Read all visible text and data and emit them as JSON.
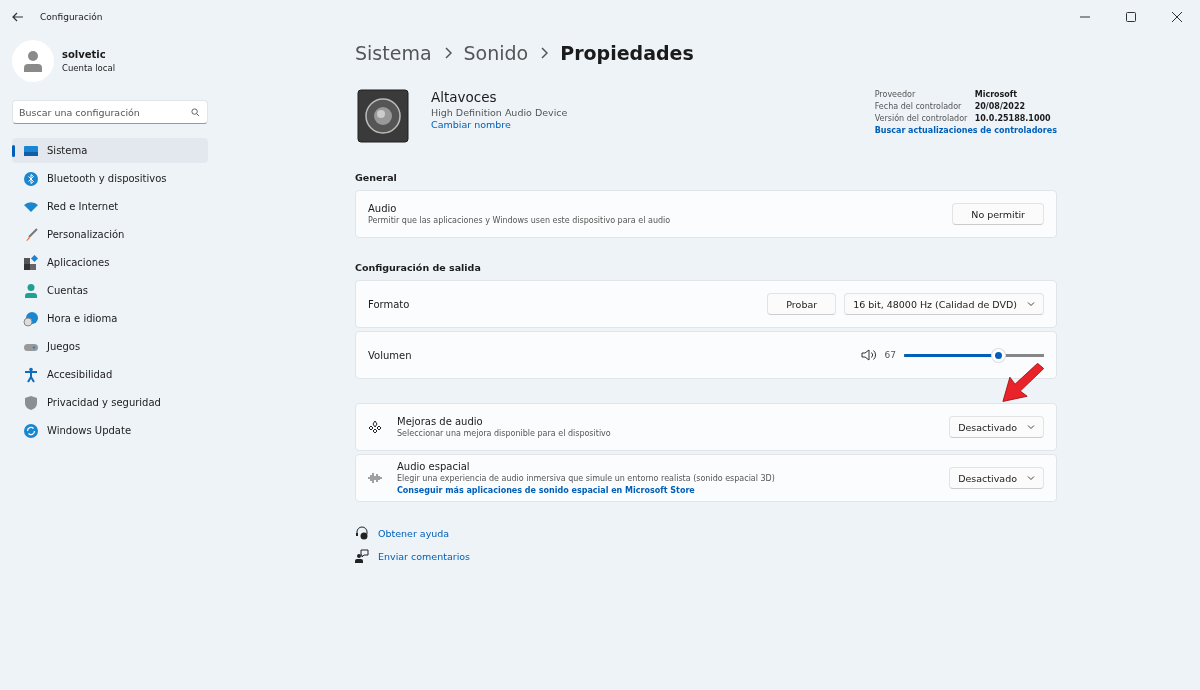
{
  "window": {
    "title": "Configuración"
  },
  "user": {
    "name": "solvetic",
    "account": "Cuenta local"
  },
  "search": {
    "placeholder": "Buscar una configuración"
  },
  "sidebar": {
    "items": [
      {
        "label": "Sistema",
        "selected": true
      },
      {
        "label": "Bluetooth y dispositivos",
        "selected": false
      },
      {
        "label": "Red e Internet",
        "selected": false
      },
      {
        "label": "Personalización",
        "selected": false
      },
      {
        "label": "Aplicaciones",
        "selected": false
      },
      {
        "label": "Cuentas",
        "selected": false
      },
      {
        "label": "Hora e idioma",
        "selected": false
      },
      {
        "label": "Juegos",
        "selected": false
      },
      {
        "label": "Accesibilidad",
        "selected": false
      },
      {
        "label": "Privacidad y seguridad",
        "selected": false
      },
      {
        "label": "Windows Update",
        "selected": false
      }
    ]
  },
  "breadcrumb": [
    "Sistema",
    "Sonido",
    "Propiedades"
  ],
  "device": {
    "name": "Altavoces",
    "description": "High Definition Audio Device",
    "rename_link": "Cambiar nombre",
    "details": [
      {
        "label": "Proveedor",
        "value": "Microsoft"
      },
      {
        "label": "Fecha del controlador",
        "value": "20/08/2022"
      },
      {
        "label": "Versión del controlador",
        "value": "10.0.25188.1000"
      }
    ],
    "update_link": "Buscar actualizaciones de controladores"
  },
  "sections": [
    {
      "title": "General",
      "cards": [
        {
          "kind": "button",
          "title": "Audio",
          "subtitle": "Permitir que las aplicaciones y Windows usen este dispositivo para el audio",
          "button": "No permitir"
        }
      ]
    },
    {
      "title": "Configuración de salida",
      "cards": [
        {
          "kind": "format",
          "title": "Formato",
          "button": "Probar",
          "dropdown": "16 bit, 48000 Hz (Calidad de DVD)"
        },
        {
          "kind": "slider",
          "title": "Volumen",
          "reading": "67",
          "level": 0.67
        }
      ]
    },
    {
      "cards": [
        {
          "kind": "dropdown",
          "title": "Mejoras de audio",
          "subtitle": "Seleccionar una mejora disponible para el dispositivo",
          "dropdown": "Desactivado"
        },
        {
          "kind": "dropdown",
          "title": "Audio espacial",
          "subtitle": "Elegir una experiencia de audio inmersiva que simule un entorno realista (sonido espacial 3D)",
          "link": "Conseguir más aplicaciones de sonido espacial en Microsoft Store",
          "dropdown": "Desactivado"
        }
      ]
    }
  ],
  "help_links": [
    {
      "kind": "help",
      "label": "Obtener ayuda"
    },
    {
      "kind": "feedback",
      "label": "Enviar comentarios"
    }
  ]
}
